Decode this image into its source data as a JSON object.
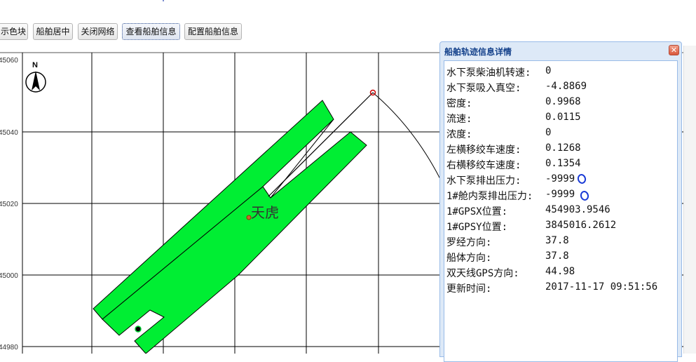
{
  "toolbar": {
    "buttons": [
      {
        "label": "示色块",
        "active": false
      },
      {
        "label": "船舶居中",
        "active": false
      },
      {
        "label": "关闭网络",
        "active": false
      },
      {
        "label": "查看船舶信息",
        "active": true
      },
      {
        "label": "配置船舶信息",
        "active": false
      }
    ]
  },
  "map": {
    "y_ticks": [
      "45060",
      "45040",
      "45020",
      "45000",
      "44980"
    ],
    "north_label": "N",
    "ship_name": "天虎",
    "colors": {
      "hull": "#00ee33",
      "grid": "#000000",
      "track": "#000000",
      "marker": "#cc0000"
    }
  },
  "panel": {
    "title": "船舶轨迹信息详情",
    "close_icon": "close-icon",
    "rows": [
      {
        "key": "水下泵柴油机转速:",
        "value": "0"
      },
      {
        "key": "水下泵吸入真空:",
        "value": "-4.8869"
      },
      {
        "key": "密度:",
        "value": "0.9968"
      },
      {
        "key": "流速:",
        "value": "0.0115"
      },
      {
        "key": "浓度:",
        "value": "0"
      },
      {
        "key": "左横移绞车速度:",
        "value": "0.1268"
      },
      {
        "key": "右横移绞车速度:",
        "value": "0.1354"
      },
      {
        "key": "水下泵排出压力:",
        "value": "-9999"
      },
      {
        "key": "1#舱内泵排出压力:",
        "value": "-9999"
      },
      {
        "key": "1#GPSX位置:",
        "value": "454903.9546"
      },
      {
        "key": "1#GPSY位置:",
        "value": "3845016.2612"
      },
      {
        "key": "罗经方向:",
        "value": "37.8"
      },
      {
        "key": "船体方向:",
        "value": "37.8"
      },
      {
        "key": "双天线GPS方向:",
        "value": "44.98"
      },
      {
        "key": "更新时间:",
        "value": "2017-11-17 09:51:56"
      }
    ]
  }
}
